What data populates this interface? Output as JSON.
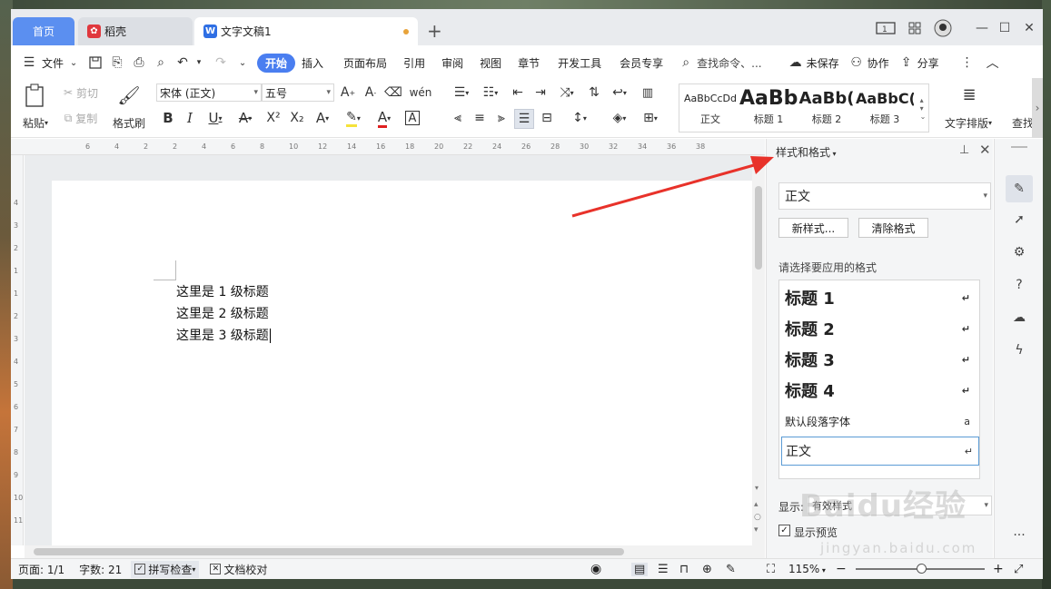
{
  "tabs": [
    {
      "label": "首页"
    },
    {
      "label": "稻壳"
    },
    {
      "label": "文字文稿1"
    }
  ],
  "menu": {
    "file": "文件",
    "items": [
      "开始",
      "插入",
      "页面布局",
      "引用",
      "审阅",
      "视图",
      "章节",
      "开发工具",
      "会员专享"
    ],
    "search_placeholder": "查找命令、...",
    "unsaved": "未保存",
    "collab": "协作",
    "share": "分享"
  },
  "ribbon": {
    "paste": "粘贴",
    "cut": "剪切",
    "copy": "复制",
    "format_painter": "格式刷",
    "font_name": "宋体 (正文)",
    "font_size": "五号",
    "styles": [
      {
        "sample": "AaBbCcDd",
        "label": "正文"
      },
      {
        "sample": "AaBb",
        "label": "标题 1"
      },
      {
        "sample": "AaBb(",
        "label": "标题 2"
      },
      {
        "sample": "AaBbC(",
        "label": "标题 3"
      }
    ],
    "text_layout": "文字排版",
    "find": "查找"
  },
  "ruler_numbers": [
    "6",
    "4",
    "2",
    "2",
    "4",
    "6",
    "8",
    "10",
    "12",
    "14",
    "16",
    "18",
    "20",
    "22",
    "24",
    "26",
    "28",
    "30",
    "32",
    "34",
    "36",
    "38"
  ],
  "vruler_numbers": [
    "4",
    "3",
    "2",
    "1",
    "1",
    "2",
    "3",
    "4",
    "5",
    "6",
    "7",
    "8",
    "9",
    "10",
    "11"
  ],
  "document": {
    "lines": [
      "这里是 1 级标题",
      "这里是 2 级标题",
      "这里是 3 级标题"
    ]
  },
  "pane": {
    "title": "样式和格式",
    "current_style": "正文",
    "new_style": "新样式...",
    "clear_format": "清除格式",
    "prompt": "请选择要应用的格式",
    "styles": [
      {
        "label": "标题  1",
        "mark": "↵"
      },
      {
        "label": "标题  2",
        "mark": "↵"
      },
      {
        "label": "标题  3",
        "mark": "↵"
      },
      {
        "label": "标题  4",
        "mark": "↵"
      },
      {
        "label": "默认段落字体",
        "mark": "a"
      },
      {
        "label": "正文",
        "mark": "↵"
      }
    ],
    "show_label": "显示:",
    "show_value": "有效样式",
    "show_preview": "显示预览"
  },
  "status": {
    "page": "页面: 1/1",
    "words": "字数: 21",
    "spell": "拼写检查",
    "proof": "文档校对",
    "zoom": "115%"
  },
  "watermark": {
    "brand": "Baidu经验",
    "url": "jingyan.baidu.com"
  },
  "colors": {
    "accent": "#4a7ef0",
    "home_tab": "#5b8ff0",
    "arrow": "#e8322a",
    "font_color": "#e02020",
    "highlight": "#f5e23a"
  }
}
